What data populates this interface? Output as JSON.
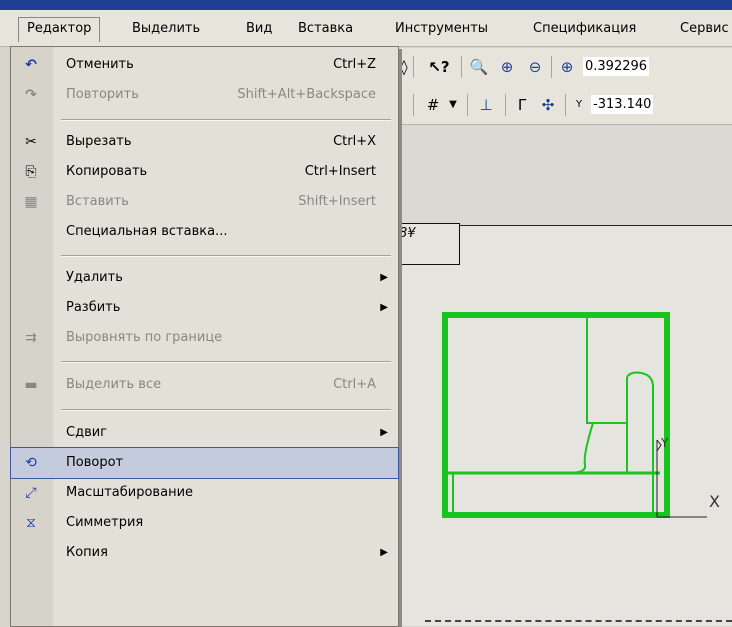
{
  "menubar": {
    "items": [
      "Редактор",
      "Выделить",
      "Вид",
      "Вставка",
      "Инструменты",
      "Спецификация",
      "Сервис"
    ]
  },
  "toolbar": {
    "zoom_value": "0.392296",
    "coord_value": "-313.140",
    "coord_axis_label": "Y"
  },
  "canvas": {
    "stamp_text": "8¥",
    "axis_x_label": "X",
    "axis_y_label": "Y",
    "drawing_color": "#19c41e"
  },
  "menu": {
    "items": [
      {
        "label": "Отменить",
        "shortcut": "Ctrl+Z",
        "icon": "undo-icon"
      },
      {
        "label": "Повторить",
        "shortcut": "Shift+Alt+Backspace",
        "icon": "redo-icon"
      },
      {
        "label": "Вырезать",
        "shortcut": "Ctrl+X",
        "icon": "scissors-icon"
      },
      {
        "label": "Копировать",
        "shortcut": "Ctrl+Insert",
        "icon": "copy-icon"
      },
      {
        "label": "Вставить",
        "shortcut": "Shift+Insert",
        "icon": "paste-icon"
      },
      {
        "label": "Специальная вставка...",
        "shortcut": ""
      },
      {
        "label": "Удалить",
        "shortcut": ""
      },
      {
        "label": "Разбить",
        "shortcut": ""
      },
      {
        "label": "Выровнять по границе",
        "shortcut": "",
        "icon": "align-boundary-icon"
      },
      {
        "label": "Выделить все",
        "shortcut": "Ctrl+A",
        "icon": "select-all-icon"
      },
      {
        "label": "Сдвиг",
        "shortcut": ""
      },
      {
        "label": "Поворот",
        "shortcut": "",
        "icon": "rotate-icon"
      },
      {
        "label": "Масштабирование",
        "shortcut": "",
        "icon": "scale-icon"
      },
      {
        "label": "Симметрия",
        "shortcut": "",
        "icon": "symmetry-icon"
      },
      {
        "label": "Копия",
        "shortcut": ""
      }
    ],
    "disabled_color": "#8a8782",
    "highlight_color": "#c3cbdc"
  }
}
